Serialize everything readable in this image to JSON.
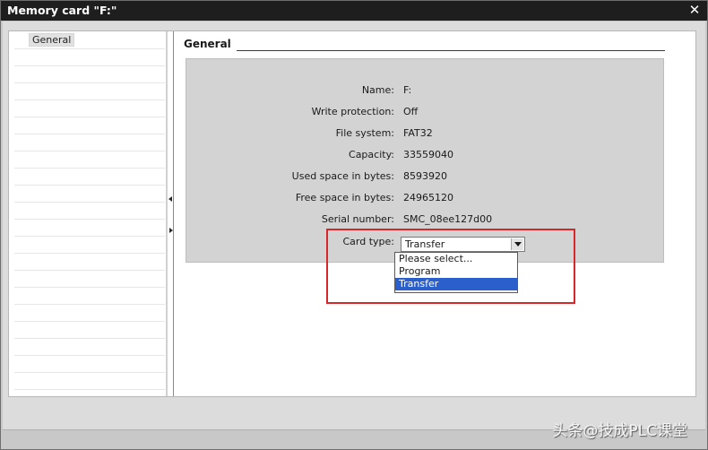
{
  "window": {
    "title": "Memory card \"F:\"",
    "close_glyph": "✕"
  },
  "nav": {
    "items": [
      {
        "label": "General"
      }
    ]
  },
  "section": {
    "title": "General"
  },
  "properties": [
    {
      "label": "Name:",
      "value": "F:"
    },
    {
      "label": "Write protection:",
      "value": "Off"
    },
    {
      "label": "File system:",
      "value": "FAT32"
    },
    {
      "label": "Capacity:",
      "value": "33559040"
    },
    {
      "label": "Used space in bytes:",
      "value": "8593920"
    },
    {
      "label": "Free space in bytes:",
      "value": "24965120"
    },
    {
      "label": "Serial number:",
      "value": "SMC_08ee127d00"
    }
  ],
  "card_type": {
    "label": "Card type:",
    "selected": "Transfer",
    "options": [
      {
        "label": "Please select..."
      },
      {
        "label": "Program"
      },
      {
        "label": "Transfer"
      }
    ]
  },
  "watermark": {
    "text": "头条@技成PLC课堂"
  },
  "colors": {
    "titlebar": "#1e1e1e",
    "selection": "#2b5fcc",
    "highlight_box": "#d9262a"
  }
}
